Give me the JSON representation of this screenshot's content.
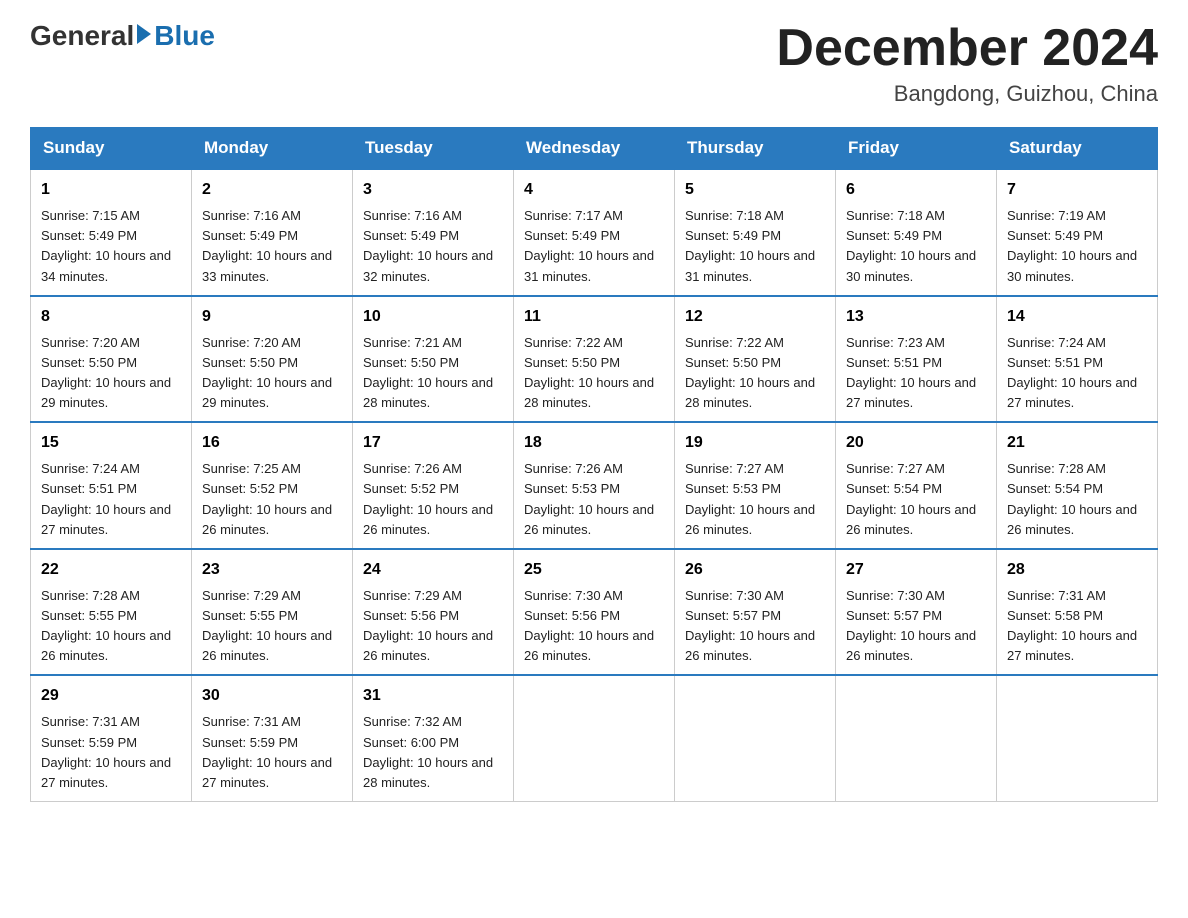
{
  "header": {
    "logo": {
      "part1": "General",
      "part2": "Blue"
    },
    "title": "December 2024",
    "location": "Bangdong, Guizhou, China"
  },
  "days_of_week": [
    "Sunday",
    "Monday",
    "Tuesday",
    "Wednesday",
    "Thursday",
    "Friday",
    "Saturday"
  ],
  "weeks": [
    [
      {
        "day": "1",
        "sunrise": "7:15 AM",
        "sunset": "5:49 PM",
        "daylight": "10 hours and 34 minutes."
      },
      {
        "day": "2",
        "sunrise": "7:16 AM",
        "sunset": "5:49 PM",
        "daylight": "10 hours and 33 minutes."
      },
      {
        "day": "3",
        "sunrise": "7:16 AM",
        "sunset": "5:49 PM",
        "daylight": "10 hours and 32 minutes."
      },
      {
        "day": "4",
        "sunrise": "7:17 AM",
        "sunset": "5:49 PM",
        "daylight": "10 hours and 31 minutes."
      },
      {
        "day": "5",
        "sunrise": "7:18 AM",
        "sunset": "5:49 PM",
        "daylight": "10 hours and 31 minutes."
      },
      {
        "day": "6",
        "sunrise": "7:18 AM",
        "sunset": "5:49 PM",
        "daylight": "10 hours and 30 minutes."
      },
      {
        "day": "7",
        "sunrise": "7:19 AM",
        "sunset": "5:49 PM",
        "daylight": "10 hours and 30 minutes."
      }
    ],
    [
      {
        "day": "8",
        "sunrise": "7:20 AM",
        "sunset": "5:50 PM",
        "daylight": "10 hours and 29 minutes."
      },
      {
        "day": "9",
        "sunrise": "7:20 AM",
        "sunset": "5:50 PM",
        "daylight": "10 hours and 29 minutes."
      },
      {
        "day": "10",
        "sunrise": "7:21 AM",
        "sunset": "5:50 PM",
        "daylight": "10 hours and 28 minutes."
      },
      {
        "day": "11",
        "sunrise": "7:22 AM",
        "sunset": "5:50 PM",
        "daylight": "10 hours and 28 minutes."
      },
      {
        "day": "12",
        "sunrise": "7:22 AM",
        "sunset": "5:50 PM",
        "daylight": "10 hours and 28 minutes."
      },
      {
        "day": "13",
        "sunrise": "7:23 AM",
        "sunset": "5:51 PM",
        "daylight": "10 hours and 27 minutes."
      },
      {
        "day": "14",
        "sunrise": "7:24 AM",
        "sunset": "5:51 PM",
        "daylight": "10 hours and 27 minutes."
      }
    ],
    [
      {
        "day": "15",
        "sunrise": "7:24 AM",
        "sunset": "5:51 PM",
        "daylight": "10 hours and 27 minutes."
      },
      {
        "day": "16",
        "sunrise": "7:25 AM",
        "sunset": "5:52 PM",
        "daylight": "10 hours and 26 minutes."
      },
      {
        "day": "17",
        "sunrise": "7:26 AM",
        "sunset": "5:52 PM",
        "daylight": "10 hours and 26 minutes."
      },
      {
        "day": "18",
        "sunrise": "7:26 AM",
        "sunset": "5:53 PM",
        "daylight": "10 hours and 26 minutes."
      },
      {
        "day": "19",
        "sunrise": "7:27 AM",
        "sunset": "5:53 PM",
        "daylight": "10 hours and 26 minutes."
      },
      {
        "day": "20",
        "sunrise": "7:27 AM",
        "sunset": "5:54 PM",
        "daylight": "10 hours and 26 minutes."
      },
      {
        "day": "21",
        "sunrise": "7:28 AM",
        "sunset": "5:54 PM",
        "daylight": "10 hours and 26 minutes."
      }
    ],
    [
      {
        "day": "22",
        "sunrise": "7:28 AM",
        "sunset": "5:55 PM",
        "daylight": "10 hours and 26 minutes."
      },
      {
        "day": "23",
        "sunrise": "7:29 AM",
        "sunset": "5:55 PM",
        "daylight": "10 hours and 26 minutes."
      },
      {
        "day": "24",
        "sunrise": "7:29 AM",
        "sunset": "5:56 PM",
        "daylight": "10 hours and 26 minutes."
      },
      {
        "day": "25",
        "sunrise": "7:30 AM",
        "sunset": "5:56 PM",
        "daylight": "10 hours and 26 minutes."
      },
      {
        "day": "26",
        "sunrise": "7:30 AM",
        "sunset": "5:57 PM",
        "daylight": "10 hours and 26 minutes."
      },
      {
        "day": "27",
        "sunrise": "7:30 AM",
        "sunset": "5:57 PM",
        "daylight": "10 hours and 26 minutes."
      },
      {
        "day": "28",
        "sunrise": "7:31 AM",
        "sunset": "5:58 PM",
        "daylight": "10 hours and 27 minutes."
      }
    ],
    [
      {
        "day": "29",
        "sunrise": "7:31 AM",
        "sunset": "5:59 PM",
        "daylight": "10 hours and 27 minutes."
      },
      {
        "day": "30",
        "sunrise": "7:31 AM",
        "sunset": "5:59 PM",
        "daylight": "10 hours and 27 minutes."
      },
      {
        "day": "31",
        "sunrise": "7:32 AM",
        "sunset": "6:00 PM",
        "daylight": "10 hours and 28 minutes."
      },
      null,
      null,
      null,
      null
    ]
  ]
}
